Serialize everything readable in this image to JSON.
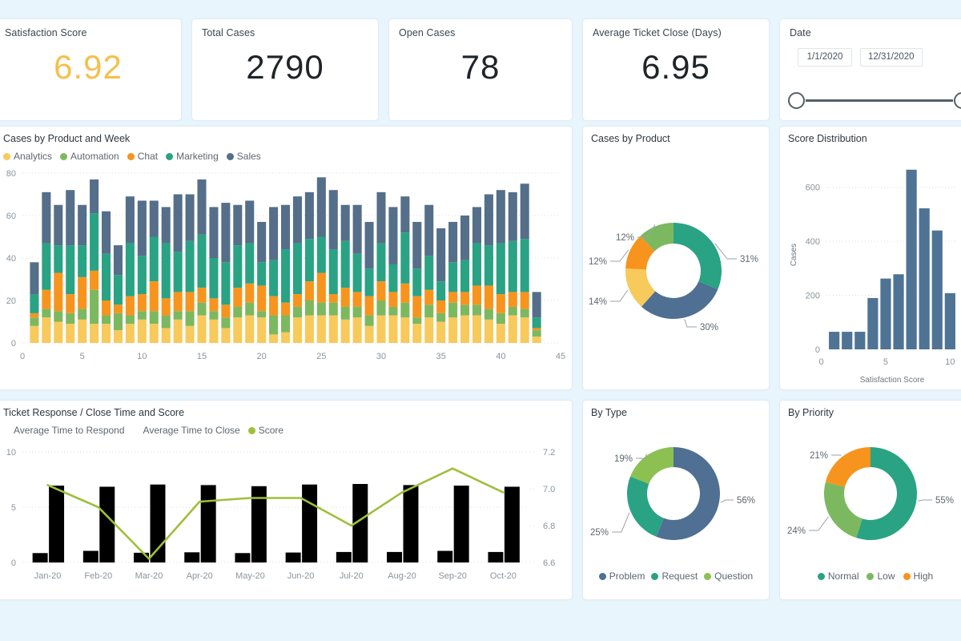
{
  "theme": {
    "background": "#e9f5fc",
    "card": "#ffffff",
    "accent_yellow": "#f5c04a",
    "text_dark": "#1f2429",
    "text_muted": "#5d6770"
  },
  "kpis": [
    {
      "title": "Satisfaction Score",
      "value": "6.92",
      "accent": true
    },
    {
      "title": "Total Cases",
      "value": "2790",
      "accent": false
    },
    {
      "title": "Open Cases",
      "value": "78",
      "accent": false
    },
    {
      "title": "Average Ticket Close (Days)",
      "value": "6.95",
      "accent": false
    }
  ],
  "date_filter": {
    "title": "Date",
    "start": "1/1/2020",
    "end": "12/31/2020"
  },
  "palette": {
    "Analytics": "#f8c95b",
    "Automation": "#7cb85f",
    "Chat": "#f7941e",
    "Marketing": "#29a383",
    "Sales": "#556e89",
    "Problem": "#4f6f93",
    "Request": "#29a383",
    "Question": "#8cc152",
    "Normal": "#29a383",
    "Low": "#7cb85f",
    "High": "#f7941e",
    "AverageTimeToRespond": "#4f6f93",
    "AverageTimeToClose": "#29a383",
    "Score": "#9fbf3b",
    "Histogram": "#4f7394"
  },
  "chart_data": [
    {
      "id": "cases-by-product-and-week",
      "type": "bar",
      "title": "Cases by Product and Week",
      "stacked": true,
      "xlabel": "",
      "ylabel": "",
      "ylim": [
        0,
        80
      ],
      "yticks": [
        0,
        20,
        40,
        60,
        80
      ],
      "xlim": [
        0,
        45
      ],
      "xticks": [
        0,
        5,
        10,
        15,
        20,
        25,
        30,
        35,
        40,
        45
      ],
      "legend_position": "top-left",
      "categories": [
        1,
        2,
        3,
        4,
        5,
        6,
        7,
        8,
        9,
        10,
        11,
        12,
        13,
        14,
        15,
        16,
        17,
        18,
        19,
        20,
        21,
        22,
        23,
        24,
        25,
        26,
        27,
        28,
        29,
        30,
        31,
        32,
        33,
        34,
        35,
        36,
        37,
        38,
        39,
        40,
        41,
        42,
        43
      ],
      "series": [
        {
          "name": "Analytics",
          "values": [
            8,
            12,
            10,
            9,
            11,
            9,
            9,
            6,
            9,
            11,
            9,
            7,
            11,
            8,
            13,
            11,
            7,
            12,
            13,
            12,
            4,
            5,
            12,
            13,
            13,
            13,
            11,
            12,
            8,
            13,
            13,
            12,
            9,
            12,
            10,
            12,
            13,
            13,
            11,
            9,
            13,
            12,
            3
          ]
        },
        {
          "name": "Automation",
          "values": [
            4,
            4,
            5,
            5,
            5,
            16,
            4,
            8,
            4,
            4,
            6,
            6,
            4,
            7,
            6,
            4,
            5,
            5,
            6,
            3,
            9,
            8,
            5,
            7,
            6,
            6,
            6,
            5,
            5,
            7,
            4,
            7,
            3,
            6,
            4,
            7,
            5,
            5,
            5,
            5,
            4,
            4,
            3
          ]
        },
        {
          "name": "Chat",
          "values": [
            2,
            9,
            18,
            9,
            15,
            9,
            7,
            4,
            9,
            8,
            14,
            8,
            9,
            9,
            7,
            6,
            6,
            9,
            9,
            12,
            9,
            6,
            6,
            9,
            14,
            4,
            9,
            7,
            9,
            9,
            7,
            9,
            10,
            7,
            6,
            5,
            6,
            9,
            11,
            9,
            7,
            8,
            1
          ]
        },
        {
          "name": "Marketing",
          "values": [
            9,
            22,
            13,
            23,
            15,
            27,
            22,
            14,
            25,
            18,
            21,
            26,
            19,
            24,
            25,
            19,
            20,
            20,
            19,
            11,
            17,
            25,
            24,
            20,
            17,
            21,
            22,
            18,
            13,
            18,
            13,
            24,
            13,
            16,
            9,
            14,
            15,
            20,
            19,
            24,
            24,
            25,
            5
          ]
        },
        {
          "name": "Sales",
          "values": [
            15,
            24,
            19,
            26,
            19,
            16,
            20,
            14,
            22,
            26,
            17,
            17,
            27,
            22,
            26,
            24,
            28,
            19,
            20,
            19,
            25,
            21,
            22,
            22,
            28,
            28,
            17,
            23,
            22,
            24,
            27,
            17,
            22,
            24,
            25,
            19,
            21,
            17,
            24,
            25,
            23,
            26,
            12
          ]
        }
      ]
    },
    {
      "id": "cases-by-product-donut",
      "type": "pie",
      "title": "Cases by Product",
      "donut": true,
      "labels": [
        "Marketing",
        "Sales",
        "Analytics",
        "Chat",
        "Automation"
      ],
      "values": [
        31,
        30,
        14,
        12,
        12
      ],
      "value_labels": [
        "31%",
        "30%",
        "14%",
        "12%",
        "12%"
      ],
      "colors": [
        "#29a383",
        "#4f6f93",
        "#f8c95b",
        "#f7941e",
        "#7cb85f"
      ],
      "legend_position": "none"
    },
    {
      "id": "score-distribution",
      "type": "bar",
      "title": "Score Distribution",
      "xlabel": "Satisfaction Score",
      "ylabel": "Cases",
      "ylim": [
        0,
        700
      ],
      "yticks": [
        0,
        200,
        400,
        600
      ],
      "xticks": [
        0,
        5,
        10
      ],
      "categories": [
        1,
        2,
        3,
        4,
        5,
        6,
        7,
        8,
        9,
        10
      ],
      "values": [
        65,
        65,
        65,
        190,
        262,
        278,
        665,
        522,
        440,
        208
      ],
      "color": "#4f7394",
      "legend_position": "none"
    },
    {
      "id": "ticket-response-close-time-and-score",
      "type": "bar",
      "title": "Ticket Response / Close Time and Score",
      "combo": true,
      "categories": [
        "Jan-20",
        "Feb-20",
        "Mar-20",
        "Apr-20",
        "May-20",
        "Jun-20",
        "Jul-20",
        "Aug-20",
        "Sep-20",
        "Oct-20"
      ],
      "ylim": [
        0,
        10
      ],
      "yticks": [
        0,
        5,
        10
      ],
      "y2lim": [
        6.6,
        7.2
      ],
      "y2ticks": [
        6.6,
        6.8,
        7.0,
        7.2
      ],
      "legend_position": "top-left",
      "series": [
        {
          "name": "Average Time to Respond",
          "type": "bar",
          "axis": "left",
          "values": [
            0.85,
            1.05,
            0.88,
            0.92,
            0.85,
            0.9,
            0.95,
            0.95,
            1.05,
            0.95
          ]
        },
        {
          "name": "Average Time to Close",
          "type": "bar",
          "axis": "left",
          "values": [
            6.95,
            6.85,
            7.05,
            7.0,
            6.9,
            7.05,
            7.1,
            7.0,
            6.95,
            6.85
          ]
        },
        {
          "name": "Score",
          "type": "line",
          "axis": "right",
          "values": [
            7.02,
            6.9,
            6.62,
            6.93,
            6.95,
            6.95,
            6.8,
            6.98,
            7.11,
            6.98
          ]
        }
      ]
    },
    {
      "id": "by-type-donut",
      "type": "pie",
      "title": "By Type",
      "donut": true,
      "labels": [
        "Problem",
        "Request",
        "Question"
      ],
      "values": [
        56,
        25,
        19
      ],
      "value_labels": [
        "56%",
        "25%",
        "19%"
      ],
      "colors": [
        "#4f6f93",
        "#29a383",
        "#8cc152"
      ],
      "legend_position": "bottom"
    },
    {
      "id": "by-priority-donut",
      "type": "pie",
      "title": "By Priority",
      "donut": true,
      "labels": [
        "Normal",
        "Low",
        "High"
      ],
      "values": [
        55,
        24,
        21
      ],
      "value_labels": [
        "55%",
        "24%",
        "21%"
      ],
      "colors": [
        "#29a383",
        "#7cb85f",
        "#f7941e"
      ],
      "legend_position": "bottom"
    }
  ]
}
